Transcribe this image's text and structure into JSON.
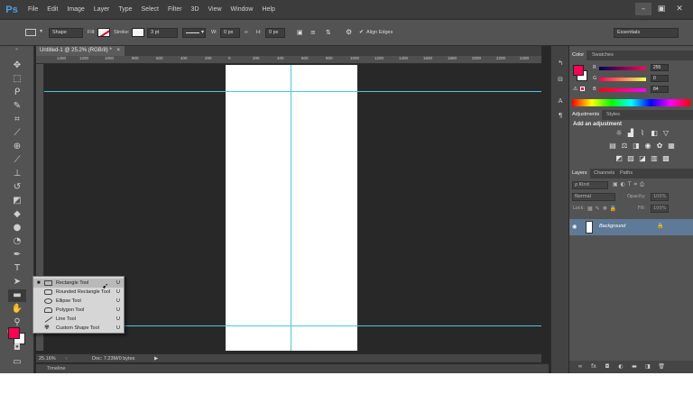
{
  "app": {
    "logo": "Ps",
    "menu": [
      "File",
      "Edit",
      "Image",
      "Layer",
      "Type",
      "Select",
      "Filter",
      "3D",
      "View",
      "Window",
      "Help"
    ],
    "window_controls": [
      "–",
      "▣",
      "✕"
    ]
  },
  "options_bar": {
    "mode": "Shape",
    "fill_label": "Fill:",
    "stroke_label": "Stroke:",
    "stroke_width": "3 pt",
    "w_label": "W:",
    "w_value": "0 px",
    "link_icon": "∞",
    "h_label": "H:",
    "h_value": "0 px",
    "align_edges": "Align Edges",
    "workspace": "Essentials"
  },
  "document": {
    "tab_title": "Untitled-1 @ 25.2% (RGB/8) *",
    "tab_close": "×",
    "ruler_labels": [
      "1400",
      "1200",
      "1000",
      "800",
      "600",
      "400",
      "200",
      "0",
      "200",
      "400",
      "600",
      "800",
      "1000",
      "1200",
      "1400",
      "1600",
      "1800",
      "2000",
      "2200",
      "2400"
    ],
    "zoom": "25.16%",
    "doc_info": "Doc: 7.23M/0 bytes",
    "timeline_label": "Timeline"
  },
  "flyout": {
    "items": [
      {
        "label": "Rectangle Tool",
        "key": "U",
        "selected": true
      },
      {
        "label": "Rounded Rectangle Tool",
        "key": "U",
        "selected": false
      },
      {
        "label": "Ellipse Tool",
        "key": "U",
        "selected": false
      },
      {
        "label": "Polygon Tool",
        "key": "U",
        "selected": false
      },
      {
        "label": "Line Tool",
        "key": "U",
        "selected": false
      },
      {
        "label": "Custom Shape Tool",
        "key": "U",
        "selected": false
      }
    ]
  },
  "color_panel": {
    "tabs": [
      "Color",
      "Swatches"
    ],
    "r_label": "R",
    "r_value": "255",
    "g_label": "G",
    "g_value": "0",
    "b_label": "B",
    "b_value": "84",
    "foreground_color": "#ff0054"
  },
  "adjustments_panel": {
    "tabs": [
      "Adjustments",
      "Styles"
    ],
    "heading": "Add an adjustment"
  },
  "layers_panel": {
    "tabs": [
      "Layers",
      "Channels",
      "Paths"
    ],
    "filter_label": "ρ Kind",
    "blend_mode": "Normal",
    "opacity_label": "Opacity:",
    "opacity_value": "100%",
    "lock_label": "Lock:",
    "fill_label": "Fill:",
    "fill_value": "100%",
    "layer_name": "Background"
  }
}
